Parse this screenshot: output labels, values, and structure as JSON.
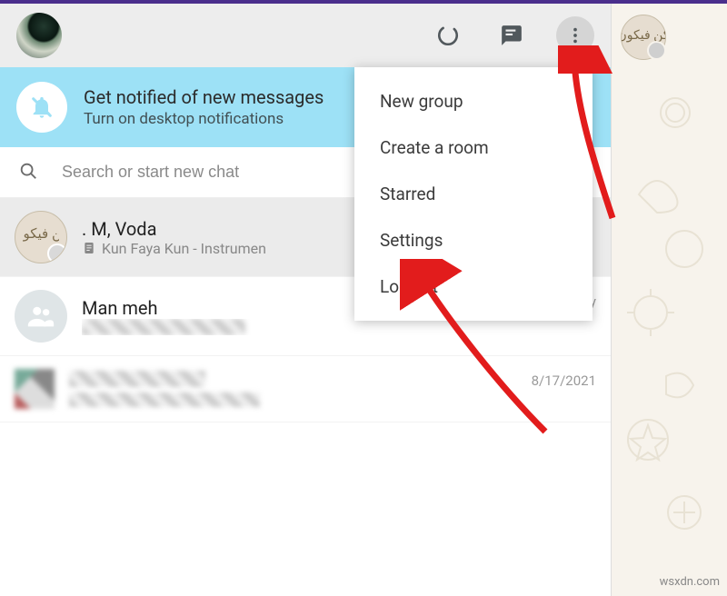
{
  "notify": {
    "title": "Get notified of new messages",
    "subtitle": "Turn on desktop notifications"
  },
  "search": {
    "placeholder": "Search or start new chat"
  },
  "dropdown": {
    "items": [
      "New group",
      "Create a room",
      "Starred",
      "Settings",
      "Log out"
    ]
  },
  "chats": [
    {
      "title": ". M, Voda",
      "subtitle": "Kun Faya Kun - Instrumen",
      "time": ""
    },
    {
      "title": "Man meh",
      "subtitle": "",
      "time": "Thursday"
    },
    {
      "title": "",
      "subtitle": "",
      "time": "8/17/2021"
    }
  ],
  "watermark": "wsxdn.com"
}
